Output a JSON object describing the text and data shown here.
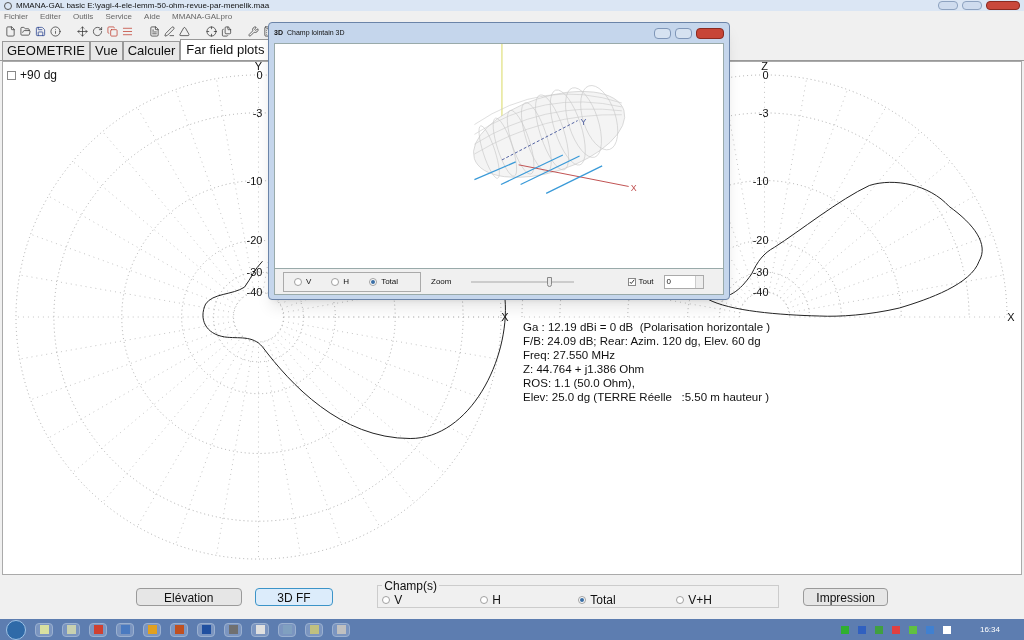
{
  "window": {
    "title": "MMANA-GAL basic E:\\yagi-4-ele-lemm-50-ohm-revue-par-menelik.maa"
  },
  "menu": [
    "Fichier",
    "Editer",
    "Outils",
    "Service",
    "Aide",
    "MMANA-GALpro"
  ],
  "tabs": [
    {
      "label": "GEOMETRIE",
      "selected": false
    },
    {
      "label": "Vue",
      "selected": false
    },
    {
      "label": "Calculer",
      "selected": false
    },
    {
      "label": "Far field plots",
      "selected": true
    }
  ],
  "plot": {
    "option": {
      "label": "+90 dg",
      "checked": false
    },
    "azimuth_plot": {
      "axis_top": "Y",
      "axis_right": "X",
      "ring_labels": [
        "0",
        "-3",
        "-10",
        "-20",
        "-30",
        "-40"
      ]
    },
    "elevation_plot": {
      "axis_top": "Z",
      "axis_right": "X",
      "ring_labels": [
        "0",
        "-3",
        "-10",
        "-20",
        "-30",
        "-40"
      ]
    },
    "info": [
      "Ga : 12.19 dBi = 0 dB  (Polarisation horizontale )",
      "F/B: 24.09 dB; Rear: Azim. 120 dg, Elev. 60 dg",
      "Freq: 27.550 MHz",
      "Z: 44.764 + j1.386 Ohm",
      "ROS: 1.1 (50.0 Ohm),",
      "Elev: 25.0 dg (TERRE Réelle   :5.50 m hauteur )"
    ]
  },
  "dialog": {
    "badge": "3D",
    "title": "Champ lointain 3D",
    "view_labels": [
      "Y",
      "X"
    ],
    "modes": [
      {
        "label": "V",
        "selected": false
      },
      {
        "label": "H",
        "selected": false
      },
      {
        "label": "Total",
        "selected": true
      }
    ],
    "zoom": {
      "label": "Zoom",
      "level": 0.76
    },
    "all": {
      "label": "Tout",
      "checked": true
    },
    "spin_value": "0"
  },
  "buttons": [
    {
      "label": "Elévation",
      "selected": false
    },
    {
      "label": "3D FF",
      "selected": true
    }
  ],
  "fields": {
    "legend": "Champ(s)",
    "options": [
      {
        "label": "V",
        "selected": false
      },
      {
        "label": "H",
        "selected": false
      },
      {
        "label": "Total",
        "selected": true
      },
      {
        "label": "V+H",
        "selected": false
      }
    ]
  },
  "print_button": "Impression",
  "taskbar": {
    "clock": "16:34"
  }
}
